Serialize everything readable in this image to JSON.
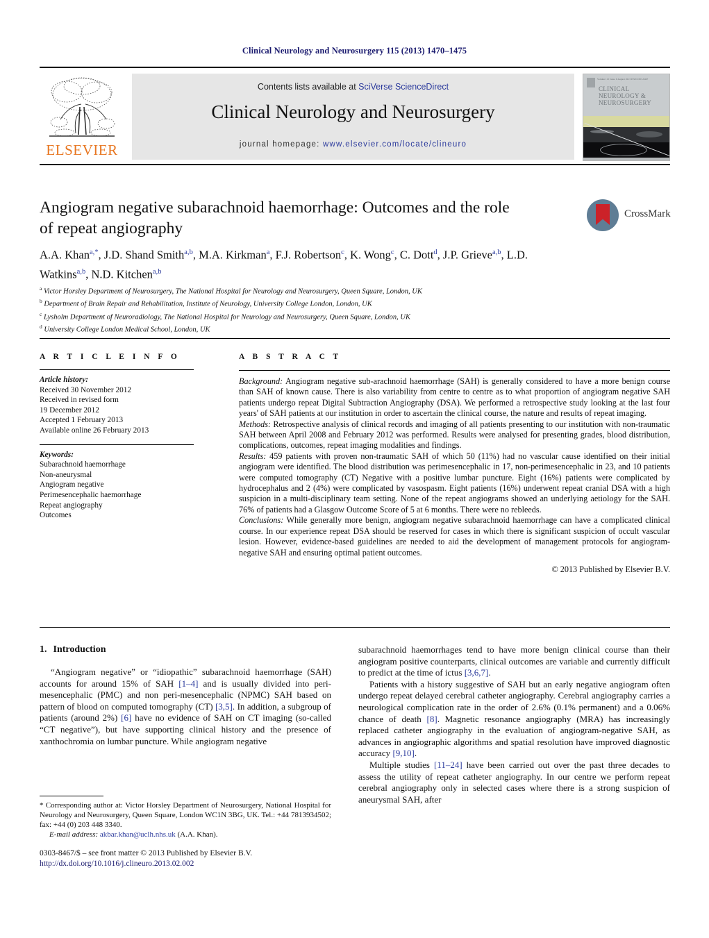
{
  "running_head": "Clinical Neurology and Neurosurgery 115 (2013) 1470–1475",
  "masthead": {
    "publisher": "ELSEVIER",
    "contents_prefix": "Contents lists available at ",
    "contents_link": "SciVerse ScienceDirect",
    "journal_title": "Clinical Neurology and Neurosurgery",
    "homepage_prefix": "journal homepage: ",
    "homepage_link": "www.elsevier.com/locate/clineuro",
    "cover": {
      "header_small": "Volume 115 Issue 9  August 2013            ISSN 0303-8467",
      "title_line1": "CLINICAL",
      "title_line2": "NEUROLOGY &",
      "title_line3": "NEUROSURGERY"
    }
  },
  "article": {
    "title": "Angiogram negative subarachnoid haemorrhage: Outcomes and the role of repeat angiography",
    "crossmark_label": "CrossMark",
    "authors_html": "A.A. Khan<sup>a,*</sup>, J.D. Shand Smith<sup>a,b</sup>, M.A. Kirkman<sup>a</sup>, F.J. Robertson<sup>c</sup>, K. Wong<sup>c</sup>, C. Dott<sup>d</sup>, J.P. Grieve<sup>a,b</sup>, L.D. Watkins<sup>a,b</sup>, N.D. Kitchen<sup>a,b</sup>",
    "affiliations": [
      {
        "marker": "a",
        "text": "Victor Horsley Department of Neurosurgery, The National Hospital for Neurology and Neurosurgery, Queen Square, London, UK"
      },
      {
        "marker": "b",
        "text": "Department of Brain Repair and Rehabilitation, Institute of Neurology, University College London, London, UK"
      },
      {
        "marker": "c",
        "text": "Lysholm Department of Neuroradiology, The National Hospital for Neurology and Neurosurgery, Queen Square, London, UK"
      },
      {
        "marker": "d",
        "text": "University College London Medical School, London, UK"
      }
    ]
  },
  "article_info": {
    "heading": "A R T I C L E   I N F O",
    "history_label": "Article history:",
    "history": [
      "Received 30 November 2012",
      "Received in revised form",
      "19 December 2012",
      "Accepted 1 February 2013",
      "Available online 26 February 2013"
    ],
    "keywords_label": "Keywords:",
    "keywords": [
      "Subarachnoid haemorrhage",
      "Non-aneurysmal",
      "Angiogram negative",
      "Perimesencephalic haemorrhage",
      "Repeat angiography",
      "Outcomes"
    ]
  },
  "abstract": {
    "heading": "A B S T R A C T",
    "sections": [
      {
        "label": "Background:",
        "text": " Angiogram negative sub-arachnoid haemorrhage (SAH) is generally considered to have a more benign course than SAH of known cause. There is also variability from centre to centre as to what proportion of angiogram negative SAH patients undergo repeat Digital Subtraction Angiography (DSA). We performed a retrospective study looking at the last four years' of SAH patients at our institution in order to ascertain the clinical course, the nature and results of repeat imaging."
      },
      {
        "label": "Methods:",
        "text": " Retrospective analysis of clinical records and imaging of all patients presenting to our institution with non-traumatic SAH between April 2008 and February 2012 was performed. Results were analysed for presenting grades, blood distribution, complications, outcomes, repeat imaging modalities and findings."
      },
      {
        "label": "Results:",
        "text": " 459 patients with proven non-traumatic SAH of which 50 (11%) had no vascular cause identified on their initial angiogram were identified. The blood distribution was perimesencephalic in 17, non-perimesencephalic in 23, and 10 patients were computed tomography (CT) Negative with a positive lumbar puncture. Eight (16%) patients were complicated by hydrocephalus and 2 (4%) were complicated by vasospasm. Eight patients (16%) underwent repeat cranial DSA with a high suspicion in a multi-disciplinary team setting. None of the repeat angiograms showed an underlying aetiology for the SAH. 76% of patients had a Glasgow Outcome Score of 5 at 6 months. There were no rebleeds."
      },
      {
        "label": "Conclusions:",
        "text": " While generally more benign, angiogram negative subarachnoid haemorrhage can have a complicated clinical course. In our experience repeat DSA should be reserved for cases in which there is significant suspicion of occult vascular lesion. However, evidence-based guidelines are needed to aid the development of management protocols for angiogram-negative SAH and ensuring optimal patient outcomes."
      }
    ],
    "copyright": "© 2013 Published by Elsevier B.V."
  },
  "introduction": {
    "number": "1.",
    "heading": "Introduction",
    "left_paragraph_html": "“Angiogram negative” or “idiopathic” subarachnoid haemorrhage (SAH) accounts for around 15% of SAH <span class=\"ref\">[1–4]</span> and is usually divided into peri-mesencephalic (PMC) and non peri-mesencephalic (NPMC) SAH based on pattern of blood on computed tomography (CT) <span class=\"ref\">[3,5]</span>. In addition, a subgroup of patients (around 2%) <span class=\"ref\">[6]</span> have no evidence of SAH on CT imaging (so-called “CT negative”), but have supporting clinical history and the presence of xanthochromia on lumbar puncture. While angiogram negative",
    "right_paragraphs_html": [
      "subarachnoid haemorrhages tend to have more benign clinical course than their angiogram positive counterparts, clinical outcomes are variable and currently difficult to predict at the time of ictus <span class=\"ref\">[3,6,7]</span>.",
      "Patients with a history suggestive of SAH but an early negative angiogram often undergo repeat delayed cerebral catheter angiography. Cerebral angiography carries a neurological complication rate in the order of 2.6% (0.1% permanent) and a 0.06% chance of death <span class=\"ref\">[8]</span>. Magnetic resonance angiography (MRA) has increasingly replaced catheter angiography in the evaluation of angiogram-negative SAH, as advances in angiographic algorithms and spatial resolution have improved diagnostic accuracy <span class=\"ref\">[9,10]</span>.",
      "Multiple studies <span class=\"ref\">[11–24]</span> have been carried out over the past three decades to assess the utility of repeat catheter angiography. In our centre we perform repeat cerebral angiography only in selected cases where there is a strong suspicion of aneurysmal SAH, after"
    ]
  },
  "footer": {
    "corresponding_html": "<span class=\"star\">*</span> Corresponding author at: Victor Horsley Department of Neurosurgery, National Hospital for Neurology and Neurosurgery, Queen Square, London WC1N 3BG, UK. Tel.: +44 7813934502; fax: +44 (0) 203 448 3340.",
    "email_html": "<span class=\"it\">E-mail address:</span> <span class=\"mail\">akbar.khan@uclh.nhs.uk</span> (A.A. Khan).",
    "issn_line": "0303-8467/$ – see front matter © 2013 Published by Elsevier B.V.",
    "doi": "http://dx.doi.org/10.1016/j.clineuro.2013.02.002"
  }
}
